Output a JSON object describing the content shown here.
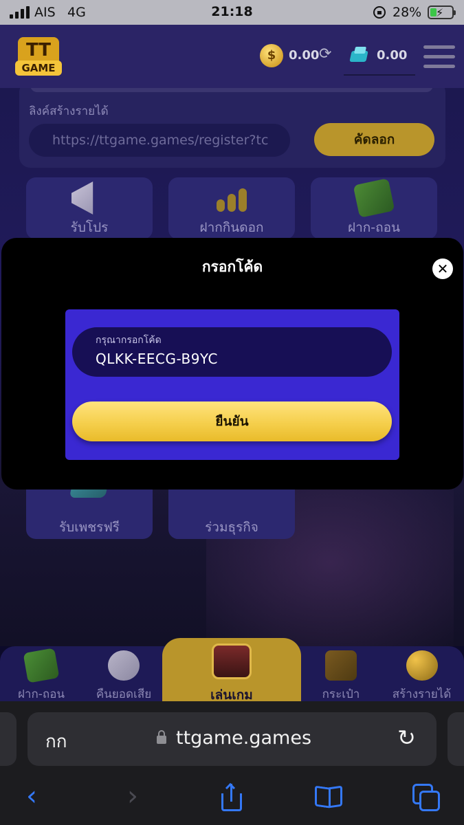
{
  "status_bar": {
    "carrier": "AIS",
    "network": "4G",
    "time": "21:18",
    "battery_percent": "28%"
  },
  "header": {
    "logo_text_top": "TT",
    "logo_text_bottom": "GAME",
    "coin_symbol": "$",
    "coin_balance": "0.00",
    "gem_balance": "0.00"
  },
  "referral": {
    "label": "ลิงค์สร้างรายได้",
    "link_value": "https://ttgame.games/register?tc",
    "copy_label": "คัดลอก"
  },
  "menu_tiles": [
    {
      "label": "รับโปร",
      "icon": "megaphone-icon"
    },
    {
      "label": "ฝากกินดอก",
      "icon": "coin-growth-chart-icon"
    },
    {
      "label": "ฝาก-ถอน",
      "icon": "money-icon"
    },
    {
      "label": "รับเพชรฟรี",
      "icon": "gem-icon"
    },
    {
      "label": "ร่วมธุรกิจ",
      "icon": "partner-icon"
    }
  ],
  "modal": {
    "title": "กรอกโค้ด",
    "close_symbol": "✕",
    "input_label": "กรุณากรอกโค้ด",
    "input_value": "QLKK-EECG-B9YC",
    "confirm_label": "ยืนยัน"
  },
  "bottom_nav": {
    "items": [
      {
        "label": "ฝาก-ถอน",
        "icon": "money-icon"
      },
      {
        "label": "คืนยอดเสีย",
        "icon": "cashback-icon"
      },
      {
        "label": "เล่นเกม",
        "icon": "slot-machine-icon"
      },
      {
        "label": "กระเป๋า",
        "icon": "wallet-icon"
      },
      {
        "label": "สร้างรายได้",
        "icon": "referral-people-icon"
      }
    ]
  },
  "browser": {
    "reader_label": "กก",
    "url": "ttgame.games"
  },
  "colors": {
    "accent_yellow": "#f5cf4c",
    "panel_blue": "#3a28d2",
    "modal_bg": "#000000",
    "ios_blue": "#3478f6"
  }
}
